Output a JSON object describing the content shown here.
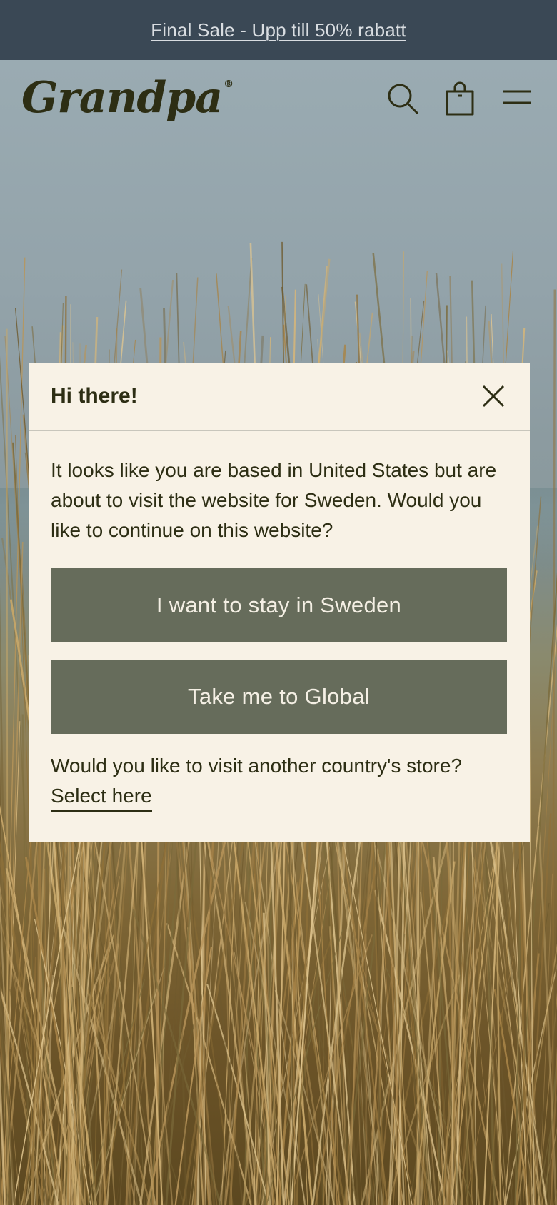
{
  "announcement": {
    "text": "Final Sale - Upp till 50% rabatt"
  },
  "header": {
    "logo_text": "Grandpa",
    "logo_mark": "®",
    "icons": {
      "search": "search-icon",
      "cart": "shopping-bag-icon",
      "menu": "hamburger-menu-icon"
    }
  },
  "modal": {
    "title": "Hi there!",
    "message": "It looks like you are based in United States but are about to visit the website for Sweden. Would you like to continue on this website?",
    "stay_button": "I want to stay in Sweden",
    "global_button": "Take me to Global",
    "other_country_text": "Would you like to visit another country's store?",
    "select_link": "Select here",
    "close_icon": "close-icon"
  },
  "colors": {
    "announcement_bg": "#3a4855",
    "modal_bg": "#f8f2e6",
    "button_bg": "#666c5b",
    "text_dark": "#2d2e14"
  }
}
